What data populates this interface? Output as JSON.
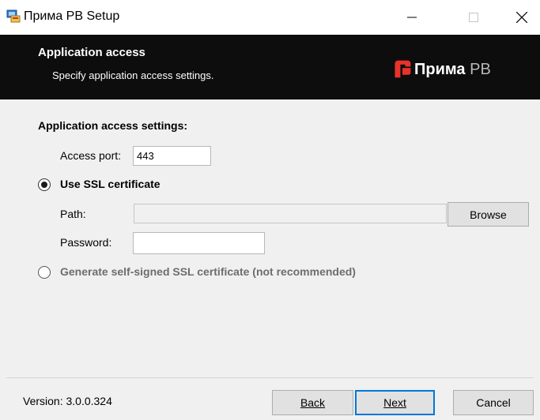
{
  "window": {
    "title": "Прима РВ Setup"
  },
  "banner": {
    "title": "Application access",
    "subtitle": "Specify application access settings.",
    "logo_bold": "Прима",
    "logo_light": "РВ"
  },
  "content": {
    "section_title": "Application access settings:",
    "access_port_label": "Access port:",
    "access_port_value": "443",
    "use_ssl_label": "Use SSL certificate",
    "path_label": "Path:",
    "path_value": "",
    "browse_label": "Browse",
    "password_label": "Password:",
    "password_value": "",
    "generate_label": "Generate self-signed SSL certificate (not recommended)"
  },
  "footer": {
    "version": "Version: 3.0.0.324",
    "back_label": "Back",
    "next_label": "Next",
    "cancel_label": "Cancel"
  },
  "colors": {
    "banner_bg": "#0d0d0d",
    "logo_red": "#e8322b",
    "default_button_border": "#0078d7"
  }
}
